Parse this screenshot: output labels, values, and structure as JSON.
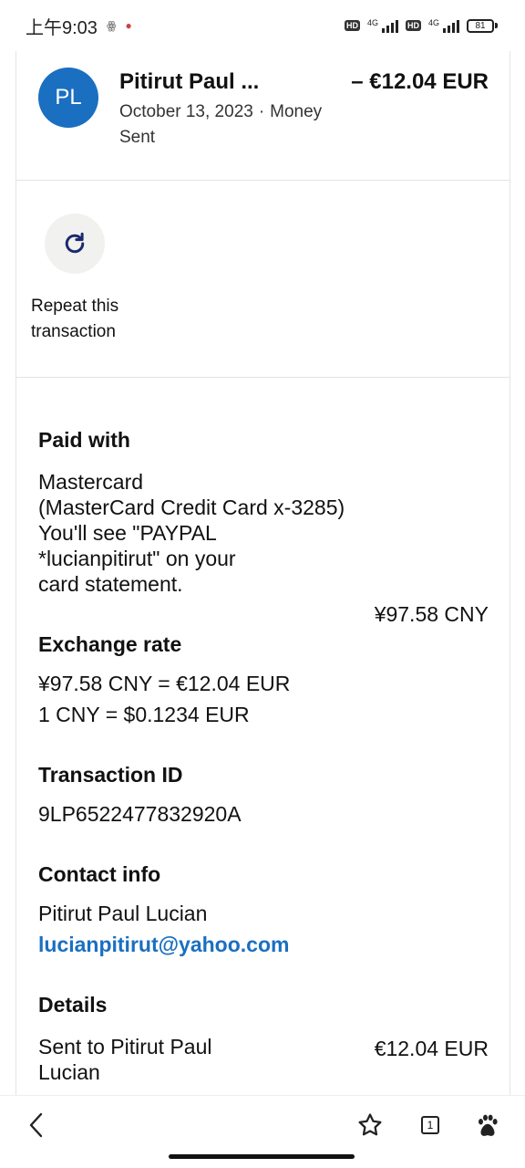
{
  "status_bar": {
    "time": "上午9:03",
    "hd1": "HD",
    "net1": "4G",
    "hd2": "HD",
    "net2": "4G",
    "battery": "81"
  },
  "transaction": {
    "avatar_initials": "PL",
    "name": "Pitirut Paul ...",
    "amount": "– €12.04 EUR",
    "date": "October 13, 2023",
    "type": "Money Sent"
  },
  "repeat": {
    "icon": "refresh-icon",
    "label": "Repeat this transaction"
  },
  "paid_with": {
    "heading": "Paid with",
    "lines": [
      "Mastercard",
      "(MasterCard Credit Card x-3285)",
      "You'll see \"PAYPAL",
      "*lucianpitirut\" on your",
      "card statement."
    ],
    "amount": "¥97.58 CNY"
  },
  "exchange_rate": {
    "heading": "Exchange rate",
    "line1": "¥97.58 CNY = €12.04 EUR",
    "line2": "1 CNY = $0.1234 EUR"
  },
  "transaction_id": {
    "heading": "Transaction ID",
    "value": "9LP6522477832920A"
  },
  "contact": {
    "heading": "Contact info",
    "name": "Pitirut Paul Lucian",
    "email": "lucianpitirut@yahoo.com"
  },
  "details": {
    "heading": "Details",
    "line1": "Sent to Pitirut Paul",
    "line2": "Lucian",
    "amount": "€12.04 EUR"
  },
  "bottom_nav": {
    "back_icon": "chevron-left-icon",
    "star_icon": "star-icon",
    "tabs_count": "1",
    "paw_icon": "paw-icon"
  },
  "colors": {
    "accent": "#1a6fc1",
    "repeat_bg": "#f1f1ef",
    "divider": "#e4e4e4"
  }
}
